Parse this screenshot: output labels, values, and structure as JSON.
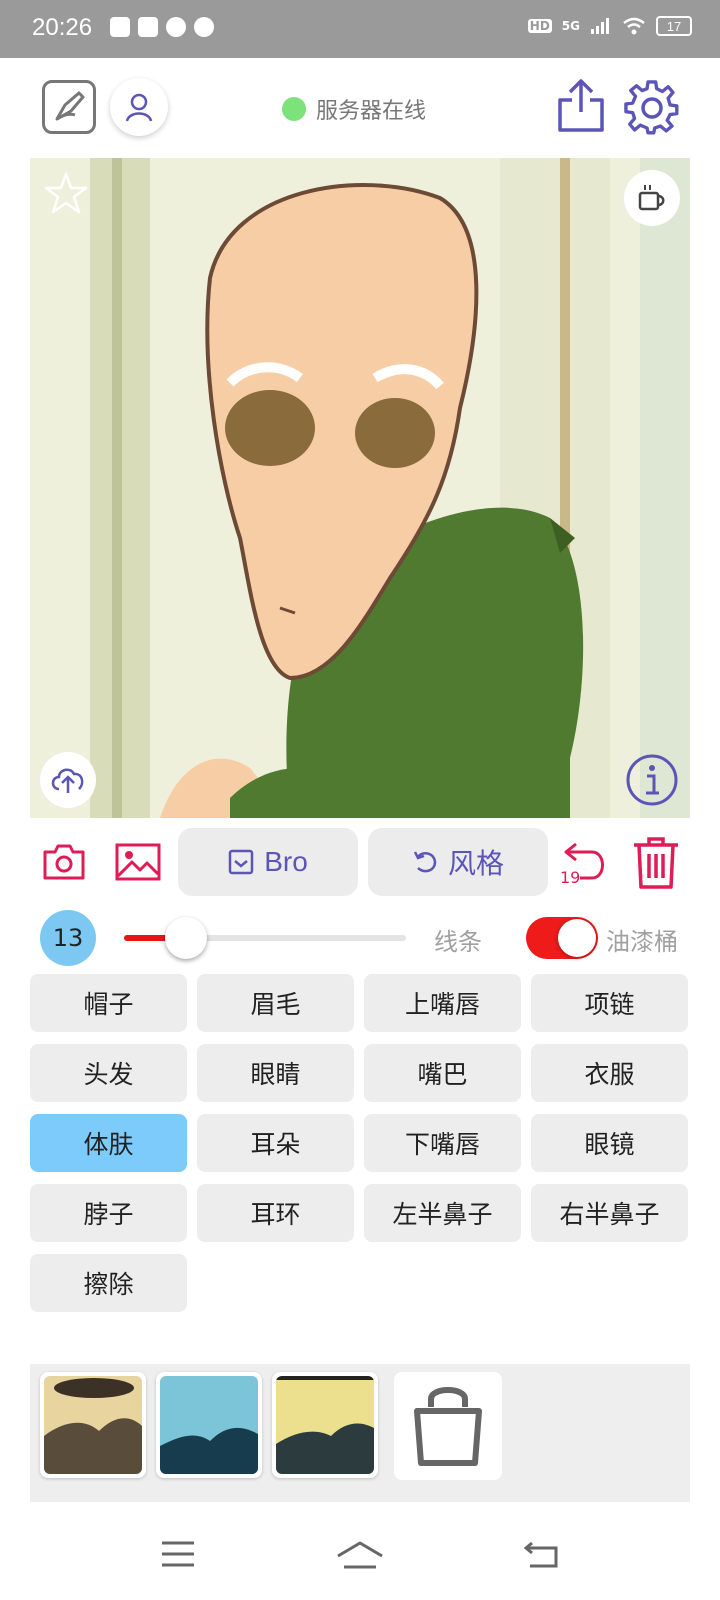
{
  "status_bar": {
    "time": "20:26",
    "hd_badge": "HD",
    "network": "5G",
    "battery": "17"
  },
  "header": {
    "server_status": "服务器在线",
    "server_status_color": "#7ee27a"
  },
  "toolbar": {
    "model_label": "Bro",
    "style_label": "风格",
    "undo_count": "19",
    "accent_color": "#e11b55",
    "primary_color": "#5b55b8"
  },
  "brush": {
    "size": "13",
    "line_label": "线条",
    "slider_fraction": 0.22,
    "bucket_label": "油漆桶",
    "bucket_enabled": true
  },
  "parts": [
    {
      "label": "帽子",
      "selected": false
    },
    {
      "label": "眉毛",
      "selected": false
    },
    {
      "label": "上嘴唇",
      "selected": false
    },
    {
      "label": "项链",
      "selected": false
    },
    {
      "label": "头发",
      "selected": false
    },
    {
      "label": "眼睛",
      "selected": false
    },
    {
      "label": "嘴巴",
      "selected": false
    },
    {
      "label": "衣服",
      "selected": false
    },
    {
      "label": "体肤",
      "selected": true
    },
    {
      "label": "耳朵",
      "selected": false
    },
    {
      "label": "下嘴唇",
      "selected": false
    },
    {
      "label": "眼镜",
      "selected": false
    },
    {
      "label": "脖子",
      "selected": false
    },
    {
      "label": "耳环",
      "selected": false
    },
    {
      "label": "左半鼻子",
      "selected": false
    },
    {
      "label": "右半鼻子",
      "selected": false
    },
    {
      "label": "擦除",
      "selected": false
    }
  ],
  "icons": {
    "logo": "sketch-logo-icon",
    "profile": "user-icon",
    "share": "share-icon",
    "settings": "gear-icon",
    "favorite": "star-icon",
    "coffee": "coffee-icon",
    "upload": "cloud-upload-icon",
    "info": "info-icon",
    "camera": "camera-icon",
    "gallery": "image-icon",
    "undo": "undo-icon",
    "delete": "trash-icon",
    "shop": "shopping-bag-icon"
  }
}
